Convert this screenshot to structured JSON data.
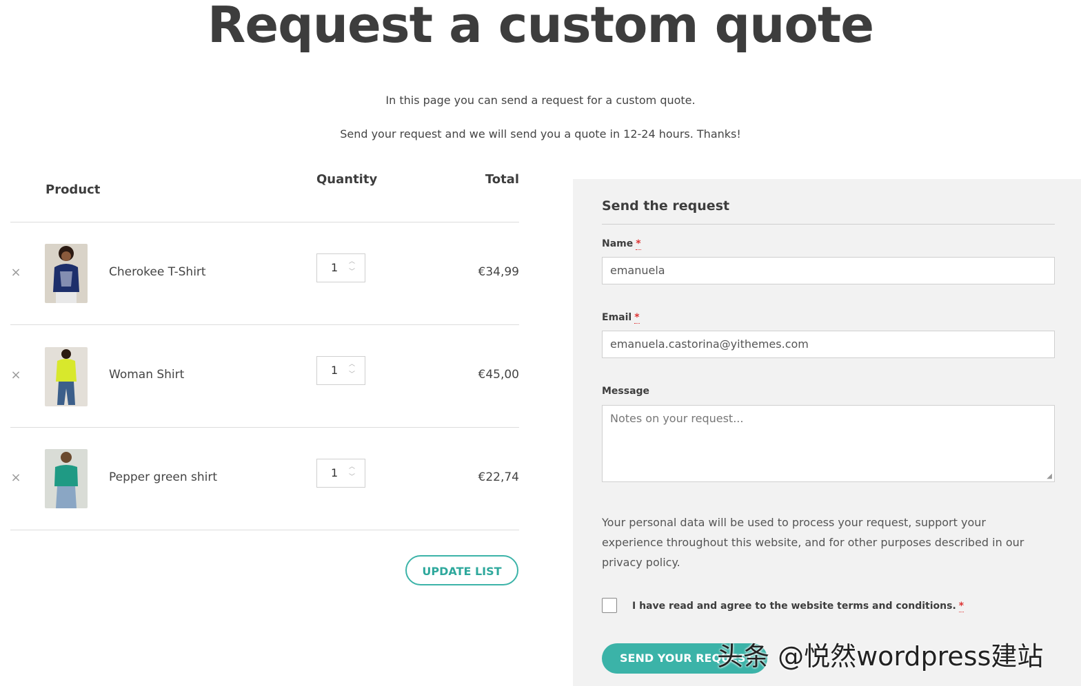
{
  "page": {
    "title": "Request a custom quote",
    "intro_line1": "In this page you can send a request for a custom quote.",
    "intro_line2": "Send your request and we will send you a quote in 12-24 hours. Thanks!"
  },
  "table": {
    "headers": {
      "product": "Product",
      "quantity": "Quantity",
      "total": "Total"
    },
    "rows": [
      {
        "remove": "×",
        "name": "Cherokee T-Shirt",
        "quantity": "1",
        "total": "€34,99"
      },
      {
        "remove": "×",
        "name": "Woman Shirt",
        "quantity": "1",
        "total": "€45,00"
      },
      {
        "remove": "×",
        "name": "Pepper green shirt",
        "quantity": "1",
        "total": "€22,74"
      }
    ],
    "update_button": "UPDATE LIST"
  },
  "form": {
    "title": "Send the request",
    "name_label": "Name",
    "name_value": "emanuela",
    "email_label": "Email",
    "email_value": "emanuela.castorina@yithemes.com",
    "message_label": "Message",
    "message_placeholder": "Notes on your request...",
    "required_mark": "*",
    "privacy_text": "Your personal data will be used to process your request, support your experience throughout this website, and for other purposes described in our privacy policy.",
    "terms_label": "I have read and agree to the website terms and conditions.",
    "submit_button": "SEND YOUR REQUEST"
  },
  "overlay": {
    "watermark": "头条 @悦然wordpress建站"
  },
  "colors": {
    "accent": "#3bb3a8",
    "required": "#dd3333",
    "panel_bg": "#f2f2f2"
  }
}
